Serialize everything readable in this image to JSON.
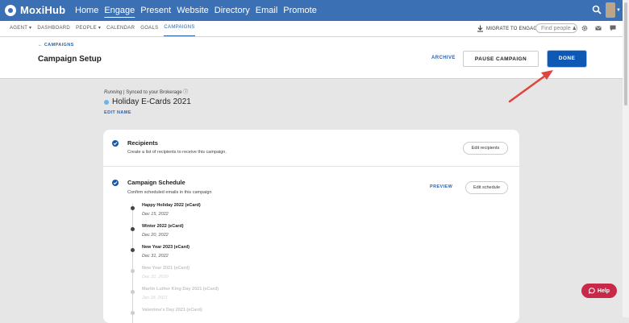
{
  "app": {
    "logo_text": "MoxiHub"
  },
  "main_nav": [
    {
      "label": "Home",
      "active": false
    },
    {
      "label": "Engage",
      "active": true
    },
    {
      "label": "Present",
      "active": false
    },
    {
      "label": "Website",
      "active": false
    },
    {
      "label": "Directory",
      "active": false
    },
    {
      "label": "Email",
      "active": false
    },
    {
      "label": "Promote",
      "active": false
    }
  ],
  "sub_nav": [
    {
      "label": "AGENT ▾",
      "active": false
    },
    {
      "label": "DASHBOARD",
      "active": false
    },
    {
      "label": "PEOPLE ▾",
      "active": false
    },
    {
      "label": "CALENDAR",
      "active": false
    },
    {
      "label": "GOALS",
      "active": false
    },
    {
      "label": "CAMPAIGNS",
      "active": true
    }
  ],
  "toolbar": {
    "migrate_label": "MIGRATE TO ENGAGE",
    "find_people_placeholder": "Find people"
  },
  "header": {
    "breadcrumb": "← CAMPAIGNS",
    "title": "Campaign Setup",
    "archive_label": "ARCHIVE",
    "pause_label": "PAUSE CAMPAIGN",
    "done_label": "DONE"
  },
  "campaign": {
    "status_running": "Running",
    "status_rest": " | Synced to your Brokerage ⓘ",
    "name": "Holiday E-Cards 2021",
    "edit_name_label": "EDIT NAME"
  },
  "recipients": {
    "title": "Recipients",
    "description": "Create a list of recipients to receive this campaign.",
    "button_label": "Edit recipients"
  },
  "schedule": {
    "title": "Campaign Schedule",
    "description": "Confirm scheduled emails in this campaign",
    "preview_label": "PREVIEW",
    "button_label": "Edit schedule",
    "items": [
      {
        "name": "Happy Holiday 2022 (eCard)",
        "date": "Dec 15, 2022",
        "faded": false
      },
      {
        "name": "Winter 2022 (eCard)",
        "date": "Dec 20, 2022",
        "faded": false
      },
      {
        "name": "New Year 2023 (eCard)",
        "date": "Dec 31, 2022",
        "faded": false
      },
      {
        "name": "New Year 2021 (eCard)",
        "date": "Dec 31, 2020",
        "faded": true
      },
      {
        "name": "Martin Luther King Day 2021 (eCard)",
        "date": "Jan 18, 2021",
        "faded": true
      },
      {
        "name": "Valentine's Day 2021 (eCard)",
        "date": "",
        "faded": true
      }
    ]
  },
  "help": {
    "label": "Help"
  },
  "colors": {
    "nav_blue": "#3c70b5",
    "accent_blue": "#0f59b5",
    "help_red": "#c72a49",
    "annotation_arrow": "#e0443e"
  }
}
